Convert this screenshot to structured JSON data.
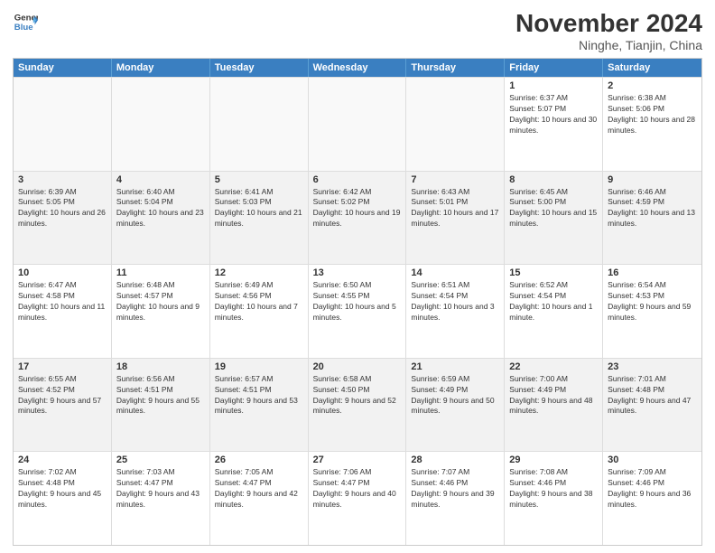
{
  "logo": {
    "line1": "General",
    "line2": "Blue"
  },
  "title": "November 2024",
  "location": "Ninghe, Tianjin, China",
  "days_of_week": [
    "Sunday",
    "Monday",
    "Tuesday",
    "Wednesday",
    "Thursday",
    "Friday",
    "Saturday"
  ],
  "rows": [
    [
      {
        "day": "",
        "info": "",
        "empty": true
      },
      {
        "day": "",
        "info": "",
        "empty": true
      },
      {
        "day": "",
        "info": "",
        "empty": true
      },
      {
        "day": "",
        "info": "",
        "empty": true
      },
      {
        "day": "",
        "info": "",
        "empty": true
      },
      {
        "day": "1",
        "info": "Sunrise: 6:37 AM\nSunset: 5:07 PM\nDaylight: 10 hours and 30 minutes.",
        "empty": false
      },
      {
        "day": "2",
        "info": "Sunrise: 6:38 AM\nSunset: 5:06 PM\nDaylight: 10 hours and 28 minutes.",
        "empty": false
      }
    ],
    [
      {
        "day": "3",
        "info": "Sunrise: 6:39 AM\nSunset: 5:05 PM\nDaylight: 10 hours and 26 minutes.",
        "empty": false
      },
      {
        "day": "4",
        "info": "Sunrise: 6:40 AM\nSunset: 5:04 PM\nDaylight: 10 hours and 23 minutes.",
        "empty": false
      },
      {
        "day": "5",
        "info": "Sunrise: 6:41 AM\nSunset: 5:03 PM\nDaylight: 10 hours and 21 minutes.",
        "empty": false
      },
      {
        "day": "6",
        "info": "Sunrise: 6:42 AM\nSunset: 5:02 PM\nDaylight: 10 hours and 19 minutes.",
        "empty": false
      },
      {
        "day": "7",
        "info": "Sunrise: 6:43 AM\nSunset: 5:01 PM\nDaylight: 10 hours and 17 minutes.",
        "empty": false
      },
      {
        "day": "8",
        "info": "Sunrise: 6:45 AM\nSunset: 5:00 PM\nDaylight: 10 hours and 15 minutes.",
        "empty": false
      },
      {
        "day": "9",
        "info": "Sunrise: 6:46 AM\nSunset: 4:59 PM\nDaylight: 10 hours and 13 minutes.",
        "empty": false
      }
    ],
    [
      {
        "day": "10",
        "info": "Sunrise: 6:47 AM\nSunset: 4:58 PM\nDaylight: 10 hours and 11 minutes.",
        "empty": false
      },
      {
        "day": "11",
        "info": "Sunrise: 6:48 AM\nSunset: 4:57 PM\nDaylight: 10 hours and 9 minutes.",
        "empty": false
      },
      {
        "day": "12",
        "info": "Sunrise: 6:49 AM\nSunset: 4:56 PM\nDaylight: 10 hours and 7 minutes.",
        "empty": false
      },
      {
        "day": "13",
        "info": "Sunrise: 6:50 AM\nSunset: 4:55 PM\nDaylight: 10 hours and 5 minutes.",
        "empty": false
      },
      {
        "day": "14",
        "info": "Sunrise: 6:51 AM\nSunset: 4:54 PM\nDaylight: 10 hours and 3 minutes.",
        "empty": false
      },
      {
        "day": "15",
        "info": "Sunrise: 6:52 AM\nSunset: 4:54 PM\nDaylight: 10 hours and 1 minute.",
        "empty": false
      },
      {
        "day": "16",
        "info": "Sunrise: 6:54 AM\nSunset: 4:53 PM\nDaylight: 9 hours and 59 minutes.",
        "empty": false
      }
    ],
    [
      {
        "day": "17",
        "info": "Sunrise: 6:55 AM\nSunset: 4:52 PM\nDaylight: 9 hours and 57 minutes.",
        "empty": false
      },
      {
        "day": "18",
        "info": "Sunrise: 6:56 AM\nSunset: 4:51 PM\nDaylight: 9 hours and 55 minutes.",
        "empty": false
      },
      {
        "day": "19",
        "info": "Sunrise: 6:57 AM\nSunset: 4:51 PM\nDaylight: 9 hours and 53 minutes.",
        "empty": false
      },
      {
        "day": "20",
        "info": "Sunrise: 6:58 AM\nSunset: 4:50 PM\nDaylight: 9 hours and 52 minutes.",
        "empty": false
      },
      {
        "day": "21",
        "info": "Sunrise: 6:59 AM\nSunset: 4:49 PM\nDaylight: 9 hours and 50 minutes.",
        "empty": false
      },
      {
        "day": "22",
        "info": "Sunrise: 7:00 AM\nSunset: 4:49 PM\nDaylight: 9 hours and 48 minutes.",
        "empty": false
      },
      {
        "day": "23",
        "info": "Sunrise: 7:01 AM\nSunset: 4:48 PM\nDaylight: 9 hours and 47 minutes.",
        "empty": false
      }
    ],
    [
      {
        "day": "24",
        "info": "Sunrise: 7:02 AM\nSunset: 4:48 PM\nDaylight: 9 hours and 45 minutes.",
        "empty": false
      },
      {
        "day": "25",
        "info": "Sunrise: 7:03 AM\nSunset: 4:47 PM\nDaylight: 9 hours and 43 minutes.",
        "empty": false
      },
      {
        "day": "26",
        "info": "Sunrise: 7:05 AM\nSunset: 4:47 PM\nDaylight: 9 hours and 42 minutes.",
        "empty": false
      },
      {
        "day": "27",
        "info": "Sunrise: 7:06 AM\nSunset: 4:47 PM\nDaylight: 9 hours and 40 minutes.",
        "empty": false
      },
      {
        "day": "28",
        "info": "Sunrise: 7:07 AM\nSunset: 4:46 PM\nDaylight: 9 hours and 39 minutes.",
        "empty": false
      },
      {
        "day": "29",
        "info": "Sunrise: 7:08 AM\nSunset: 4:46 PM\nDaylight: 9 hours and 38 minutes.",
        "empty": false
      },
      {
        "day": "30",
        "info": "Sunrise: 7:09 AM\nSunset: 4:46 PM\nDaylight: 9 hours and 36 minutes.",
        "empty": false
      }
    ]
  ]
}
